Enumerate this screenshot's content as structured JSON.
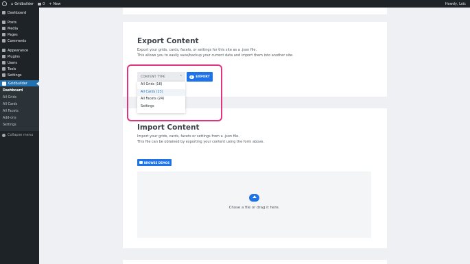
{
  "adminbar": {
    "site_name": "Gridbuilder",
    "comments_count": "0",
    "new_label": "New",
    "howdy": "Howdy, Loïc"
  },
  "sidebar": {
    "items": [
      {
        "label": "Dashboard",
        "icon": "dashboard-icon"
      },
      {
        "label": "Posts",
        "icon": "pin-icon"
      },
      {
        "label": "Media",
        "icon": "media-icon"
      },
      {
        "label": "Pages",
        "icon": "page-icon"
      },
      {
        "label": "Comments",
        "icon": "comment-icon"
      },
      {
        "label": "Appearance",
        "icon": "brush-icon"
      },
      {
        "label": "Plugins",
        "icon": "plug-icon"
      },
      {
        "label": "Users",
        "icon": "user-icon"
      },
      {
        "label": "Tools",
        "icon": "wrench-icon"
      },
      {
        "label": "Settings",
        "icon": "settings-icon"
      }
    ],
    "active_item": "Gridbuilder",
    "submenu": [
      "Dashboard",
      "All Grids",
      "All Cards",
      "All Facets",
      "Add-ons",
      "Settings"
    ],
    "collapse_label": "Collapse menu"
  },
  "export": {
    "title": "Export Content",
    "desc_line1": "Export your grids, cards, facets, or settings for this site as a .json file.",
    "desc_line2": "This allows you to easily save/backup your current data and import them into another site.",
    "select_label": "CONTENT TYPE",
    "options": [
      "All Grids (16)",
      "All Cards (23)",
      "All Facets (24)",
      "Settings"
    ],
    "selected_option": "All Cards (23)",
    "export_button": "EXPORT"
  },
  "import": {
    "title": "Import Content",
    "desc_line1": "Import your grids, cards, facets or settings from a .json file.",
    "desc_line2": "This file can be obtained by exporting your content using the form above.",
    "demos_button": "BROWSE DEMOS",
    "drop_text": "Chose a file or drag it here."
  },
  "colors": {
    "accent": "#1e73e8",
    "highlight": "#e0357e",
    "sidebar_bg": "#1d2327",
    "active_menu": "#2271b1"
  }
}
